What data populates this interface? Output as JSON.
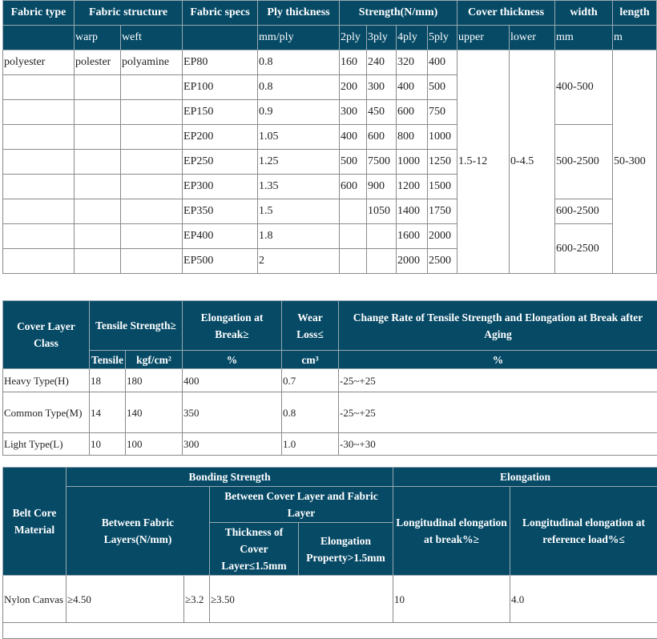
{
  "table1": {
    "headers": [
      "Fabric type",
      "Fabric structure",
      "Fabric specs",
      "Ply thickness",
      "Strength(N/mm)",
      "Cover thickness",
      "width",
      "length"
    ],
    "subheaders": [
      "warp",
      "weft",
      "mm/ply",
      "2ply",
      "3ply",
      "4ply",
      "5ply",
      "upper",
      "lower",
      "mm",
      "m"
    ],
    "rows": [
      {
        "type": "polyester",
        "warp": "polester",
        "weft": "polyamine",
        "spec": "EP80",
        "ply": " 0.8",
        "s": [
          "160",
          "240",
          "320",
          "400"
        ]
      },
      {
        "type": "",
        "warp": "",
        "weft": "",
        "spec": "EP100",
        "ply": "0.8",
        "s": [
          "200",
          "300",
          "400",
          "500"
        ]
      },
      {
        "type": "",
        "warp": "",
        "weft": "",
        "spec": "EP150",
        "ply": "0.9",
        "s": [
          "300",
          "450",
          "600",
          "750"
        ]
      },
      {
        "type": "",
        "warp": "",
        "weft": "",
        "spec": "EP200",
        "ply": "1.05",
        "s": [
          "400",
          "600",
          "800",
          "1000"
        ]
      },
      {
        "type": "",
        "warp": "",
        "weft": "",
        "spec": "EP250",
        "ply": "1.25",
        "s": [
          "500",
          "7500",
          "1000",
          "1250"
        ]
      },
      {
        "type": "",
        "warp": "",
        "weft": "",
        "spec": "EP300",
        "ply": "1.35",
        "s": [
          "600",
          "900",
          "1200",
          "1500"
        ]
      },
      {
        "type": "",
        "warp": "",
        "weft": "",
        "spec": "EP350",
        "ply": "1.5",
        "s": [
          "",
          "1050",
          "1400",
          "1750"
        ]
      },
      {
        "type": "",
        "warp": "",
        "weft": "",
        "spec": "EP400",
        "ply": "1.8",
        "s": [
          "",
          "",
          "1600",
          "2000"
        ]
      },
      {
        "type": "",
        "warp": "",
        "weft": "",
        "spec": "EP500",
        "ply": "2",
        "s": [
          "",
          "",
          "2000",
          "2500"
        ]
      }
    ],
    "cover_upper": "1.5-12",
    "cover_lower": "0-4.5",
    "widths": [
      "400-500",
      "500-2500",
      "600-2500",
      "600-2500"
    ],
    "length": "50-300"
  },
  "table2": {
    "headers": [
      "Cover Layer Class",
      "Tensile Strength≥",
      "Elongation at Break≥",
      "Wear Loss≤",
      "Change Rate of Tensile Strength and Elongation at Break after Aging"
    ],
    "subheaders": [
      "Tensile",
      "kgf/cm²",
      "%",
      "cm³",
      "%"
    ],
    "rows": [
      [
        "Heavy Type(H)",
        "18",
        "180",
        "400",
        "0.7",
        "-25~+25"
      ],
      [
        "Common Type(M)",
        "14",
        "140",
        "350",
        "0.8",
        "-25~+25"
      ],
      [
        "Light Type(L)",
        "10",
        "100",
        "300",
        "1.0",
        "-30~+30"
      ]
    ]
  },
  "table3": {
    "belt_core": "Belt Core Material",
    "bonding": "Bonding Strength",
    "elongation": "Elongation",
    "between_fabric": "Between Fabric Layers(N/mm)",
    "between_cover": "Between Cover Layer and Fabric Layer",
    "long_break": "Longitudinal elongation at break%≥",
    "long_ref": "Longitudinal elongation at reference load%≤",
    "thickness": "Thickness of Cover Layer≤1.5mm",
    "elong_prop": "Elongation Property>1.5mm",
    "rows": [
      [
        "Nylon Canvas",
        "≥4.50",
        "≥3.2",
        "≥3.50",
        "10",
        "4.0"
      ]
    ]
  }
}
